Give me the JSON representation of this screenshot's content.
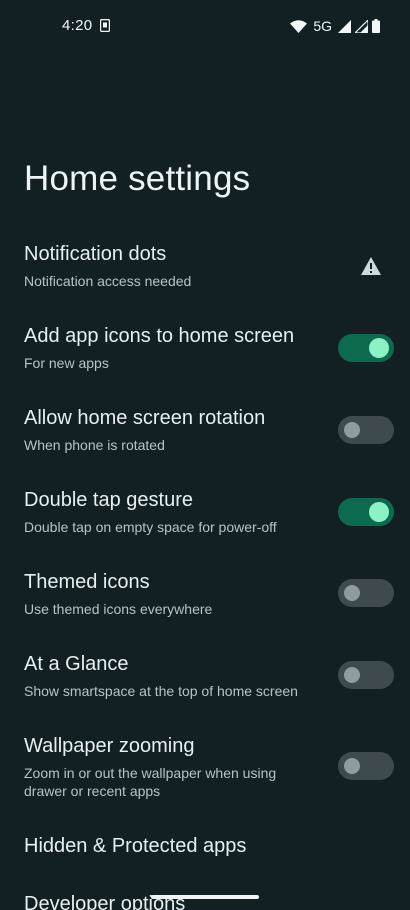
{
  "status_bar": {
    "time": "4:20",
    "network": "5G",
    "icons": [
      "sim-notification-icon",
      "wifi-icon",
      "signal-icon",
      "signal-icon",
      "battery-icon"
    ]
  },
  "page": {
    "title": "Home settings"
  },
  "settings": [
    {
      "title": "Notification dots",
      "subtitle": "Notification access needed",
      "control": "warning-icon"
    },
    {
      "title": "Add app icons to home screen",
      "subtitle": "For new apps",
      "control": "toggle",
      "enabled": true
    },
    {
      "title": "Allow home screen rotation",
      "subtitle": "When phone is rotated",
      "control": "toggle",
      "enabled": false
    },
    {
      "title": "Double tap gesture",
      "subtitle": "Double tap on empty space for power-off",
      "control": "toggle",
      "enabled": true
    },
    {
      "title": "Themed icons",
      "subtitle": "Use themed icons everywhere",
      "control": "toggle",
      "enabled": false
    },
    {
      "title": "At a Glance",
      "subtitle": "Show smartspace at the top of home screen",
      "control": "toggle",
      "enabled": false
    },
    {
      "title": "Wallpaper zooming",
      "subtitle": "Zoom in or out the wallpaper when using drawer or recent apps",
      "control": "toggle",
      "enabled": false
    }
  ],
  "links": [
    {
      "label": "Hidden & Protected apps"
    },
    {
      "label": "Developer options"
    }
  ],
  "colors": {
    "background": "#122023",
    "toggle_on_track": "#0d6a4f",
    "toggle_on_knob": "#8cf2c6",
    "toggle_off_track": "#3e4a4d",
    "toggle_off_knob": "#8c9c9f"
  }
}
